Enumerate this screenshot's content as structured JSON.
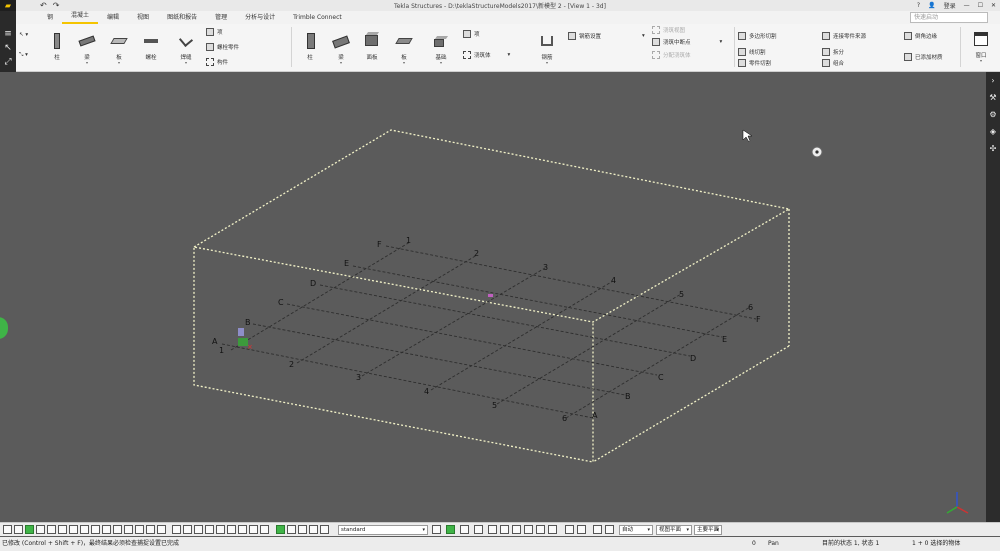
{
  "window": {
    "title": "Tekla Structures - D:\\teklaStructureModels2017\\新模型 2 - [View 1 - 3d]",
    "help": "?",
    "login_label": "登录"
  },
  "tabs": [
    {
      "label": "钢"
    },
    {
      "label": "混凝土"
    },
    {
      "label": "编辑"
    },
    {
      "label": "视图"
    },
    {
      "label": "图纸和报告"
    },
    {
      "label": "管理"
    },
    {
      "label": "分析与设计"
    },
    {
      "label": "Trimble Connect"
    }
  ],
  "search": {
    "placeholder": "快速启动"
  },
  "ribbon": {
    "steel": {
      "column": "柱",
      "beam": "梁",
      "plate": "板",
      "bolt": "螺栓",
      "weld": "焊缝",
      "item": "项",
      "bolt_part": "螺栓零件",
      "component": "构件"
    },
    "concrete": {
      "column": "柱",
      "beam": "梁",
      "panel": "面板",
      "slab": "板",
      "footing": "基础",
      "item": "项",
      "pour": "浇筑体",
      "rebar": "钢筋",
      "rebar_set": "钢筋设置",
      "pour_view": "浇筑视图",
      "pour_break": "浇筑中断点",
      "pour_unit": "分配浇筑体"
    },
    "edit": {
      "polygon_cut": "多边形切割",
      "line_cut": "线切割",
      "part_cut": "零件切割",
      "connect_parts": "连接零件来源",
      "split": "拆分",
      "combine": "组合",
      "chamfer": "倒角边缘",
      "added_material": "已添加材质"
    },
    "window_label": "窗口"
  },
  "viewport": {
    "grid_labels_front": [
      "A",
      "B",
      "C",
      "D",
      "E",
      "F"
    ],
    "grid_labels_back": [
      "A",
      "B",
      "C",
      "D",
      "E",
      "F"
    ],
    "grid_numbers_front": [
      "1",
      "2",
      "3",
      "4",
      "5",
      "6"
    ],
    "grid_numbers_back": [
      "1",
      "2",
      "3",
      "4",
      "5",
      "6"
    ]
  },
  "bottombar": {
    "view_filter": "standard",
    "snap_mode": "自动",
    "plane": "视图平面",
    "plane2": "主要平面"
  },
  "statusbar": {
    "hint": "已修改 (Control + Shift + F)，最终结果必须检查捕捉设置已完成",
    "coord": "0",
    "mode": "Pan",
    "selection": "目前的状态 1, 状态 1",
    "selected_count": "1 + 0 选择的物体"
  }
}
